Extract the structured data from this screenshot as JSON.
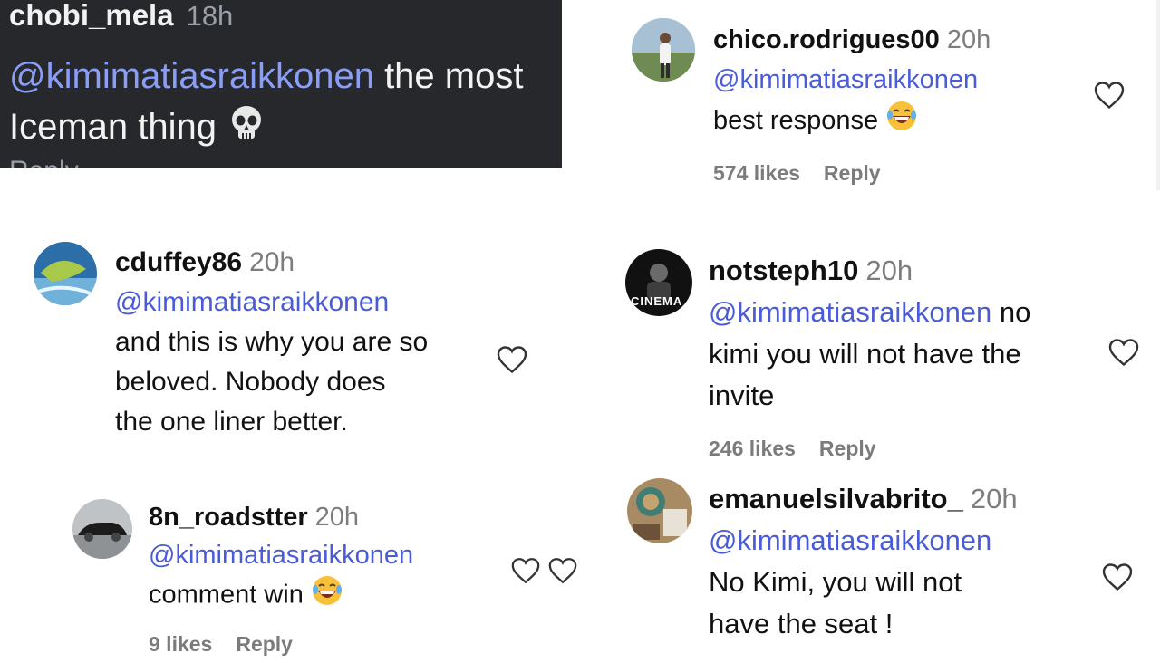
{
  "top_left": {
    "username": "chobi_mela",
    "time": "18h",
    "mention": "@kimimatiasraikkonen",
    "text": " the most Iceman thing",
    "emoji": "skull-emoji",
    "cut_text": "Reply"
  },
  "top_right": {
    "username": "chico.rodrigues00",
    "time": "20h",
    "mention": "@kimimatiasraikkonen",
    "text": "best response",
    "emoji": "laughing-emoji",
    "likes": "574 likes",
    "reply": "Reply"
  },
  "mid_left": {
    "username": "cduffey86",
    "time": "20h",
    "mention": "@kimimatiasraikkonen",
    "lines": [
      "and this is why you are so",
      "beloved. Nobody does",
      "the one liner better."
    ]
  },
  "reply_left": {
    "username": "8n_roadstter",
    "time": "20h",
    "mention": "@kimimatiasraikkonen",
    "text": "comment win",
    "emoji": "laughing-emoji",
    "likes": "9 likes",
    "reply": "Reply"
  },
  "mid_right": {
    "username": "notsteph10",
    "time": "20h",
    "mention": "@kimimatiasraikkonen",
    "text_after_mention": " no",
    "lines": [
      "kimi you will not have the",
      "invite"
    ],
    "avatar_text": "CINEMA",
    "likes": "246 likes",
    "reply": "Reply"
  },
  "bottom_right": {
    "username": "emanuelsilvabrito_",
    "time": "20h",
    "mention": "@kimimatiasraikkonen",
    "lines": [
      "No Kimi, you will not",
      "have the seat !"
    ]
  },
  "icons": {
    "heart": "heart-outline-icon"
  },
  "colors": {
    "mention_light": "#4a5bd8",
    "mention_dark": "#8a9ef7",
    "dark_bg": "#26282c"
  }
}
